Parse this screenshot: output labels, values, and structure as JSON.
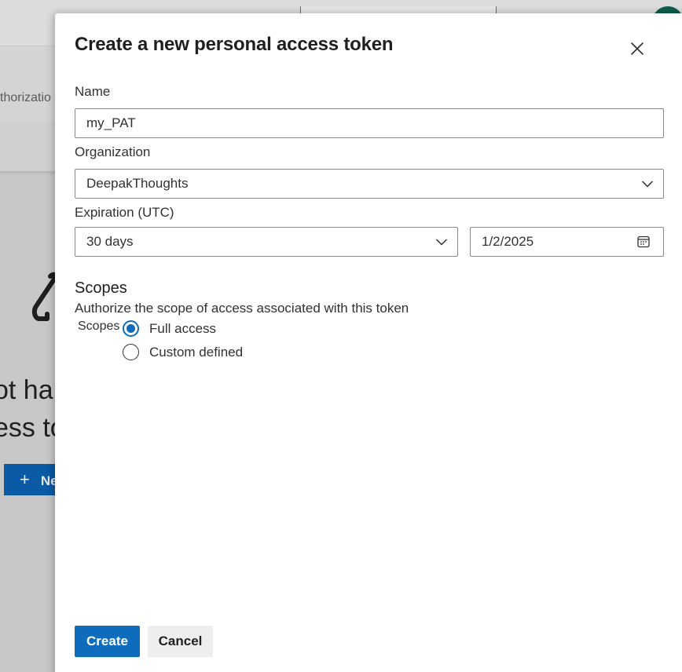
{
  "background": {
    "tab_text": "thorizatio",
    "empty_line1": "ot ha",
    "empty_line2": "ess to",
    "new_button_label": "Ne"
  },
  "dialog": {
    "title": "Create a new personal access token",
    "name": {
      "label": "Name",
      "value": "my_PAT"
    },
    "organization": {
      "label": "Organization",
      "value": "DeepakThoughts"
    },
    "expiration": {
      "label": "Expiration (UTC)",
      "period": "30 days",
      "date": "1/2/2025"
    },
    "scopes": {
      "title": "Scopes",
      "description": "Authorize the scope of access associated with this token",
      "group_label": "Scopes",
      "options": [
        {
          "label": "Full access",
          "checked": true
        },
        {
          "label": "Custom defined",
          "checked": false
        }
      ]
    },
    "buttons": {
      "create": "Create",
      "cancel": "Cancel"
    }
  },
  "colors": {
    "accent": "#0f6cbd",
    "overlay_bg": "#c8c8c8",
    "avatar": "#0b5e4b"
  },
  "icons": [
    "close-icon",
    "chevron-down-icon",
    "calendar-icon",
    "plus-icon"
  ]
}
